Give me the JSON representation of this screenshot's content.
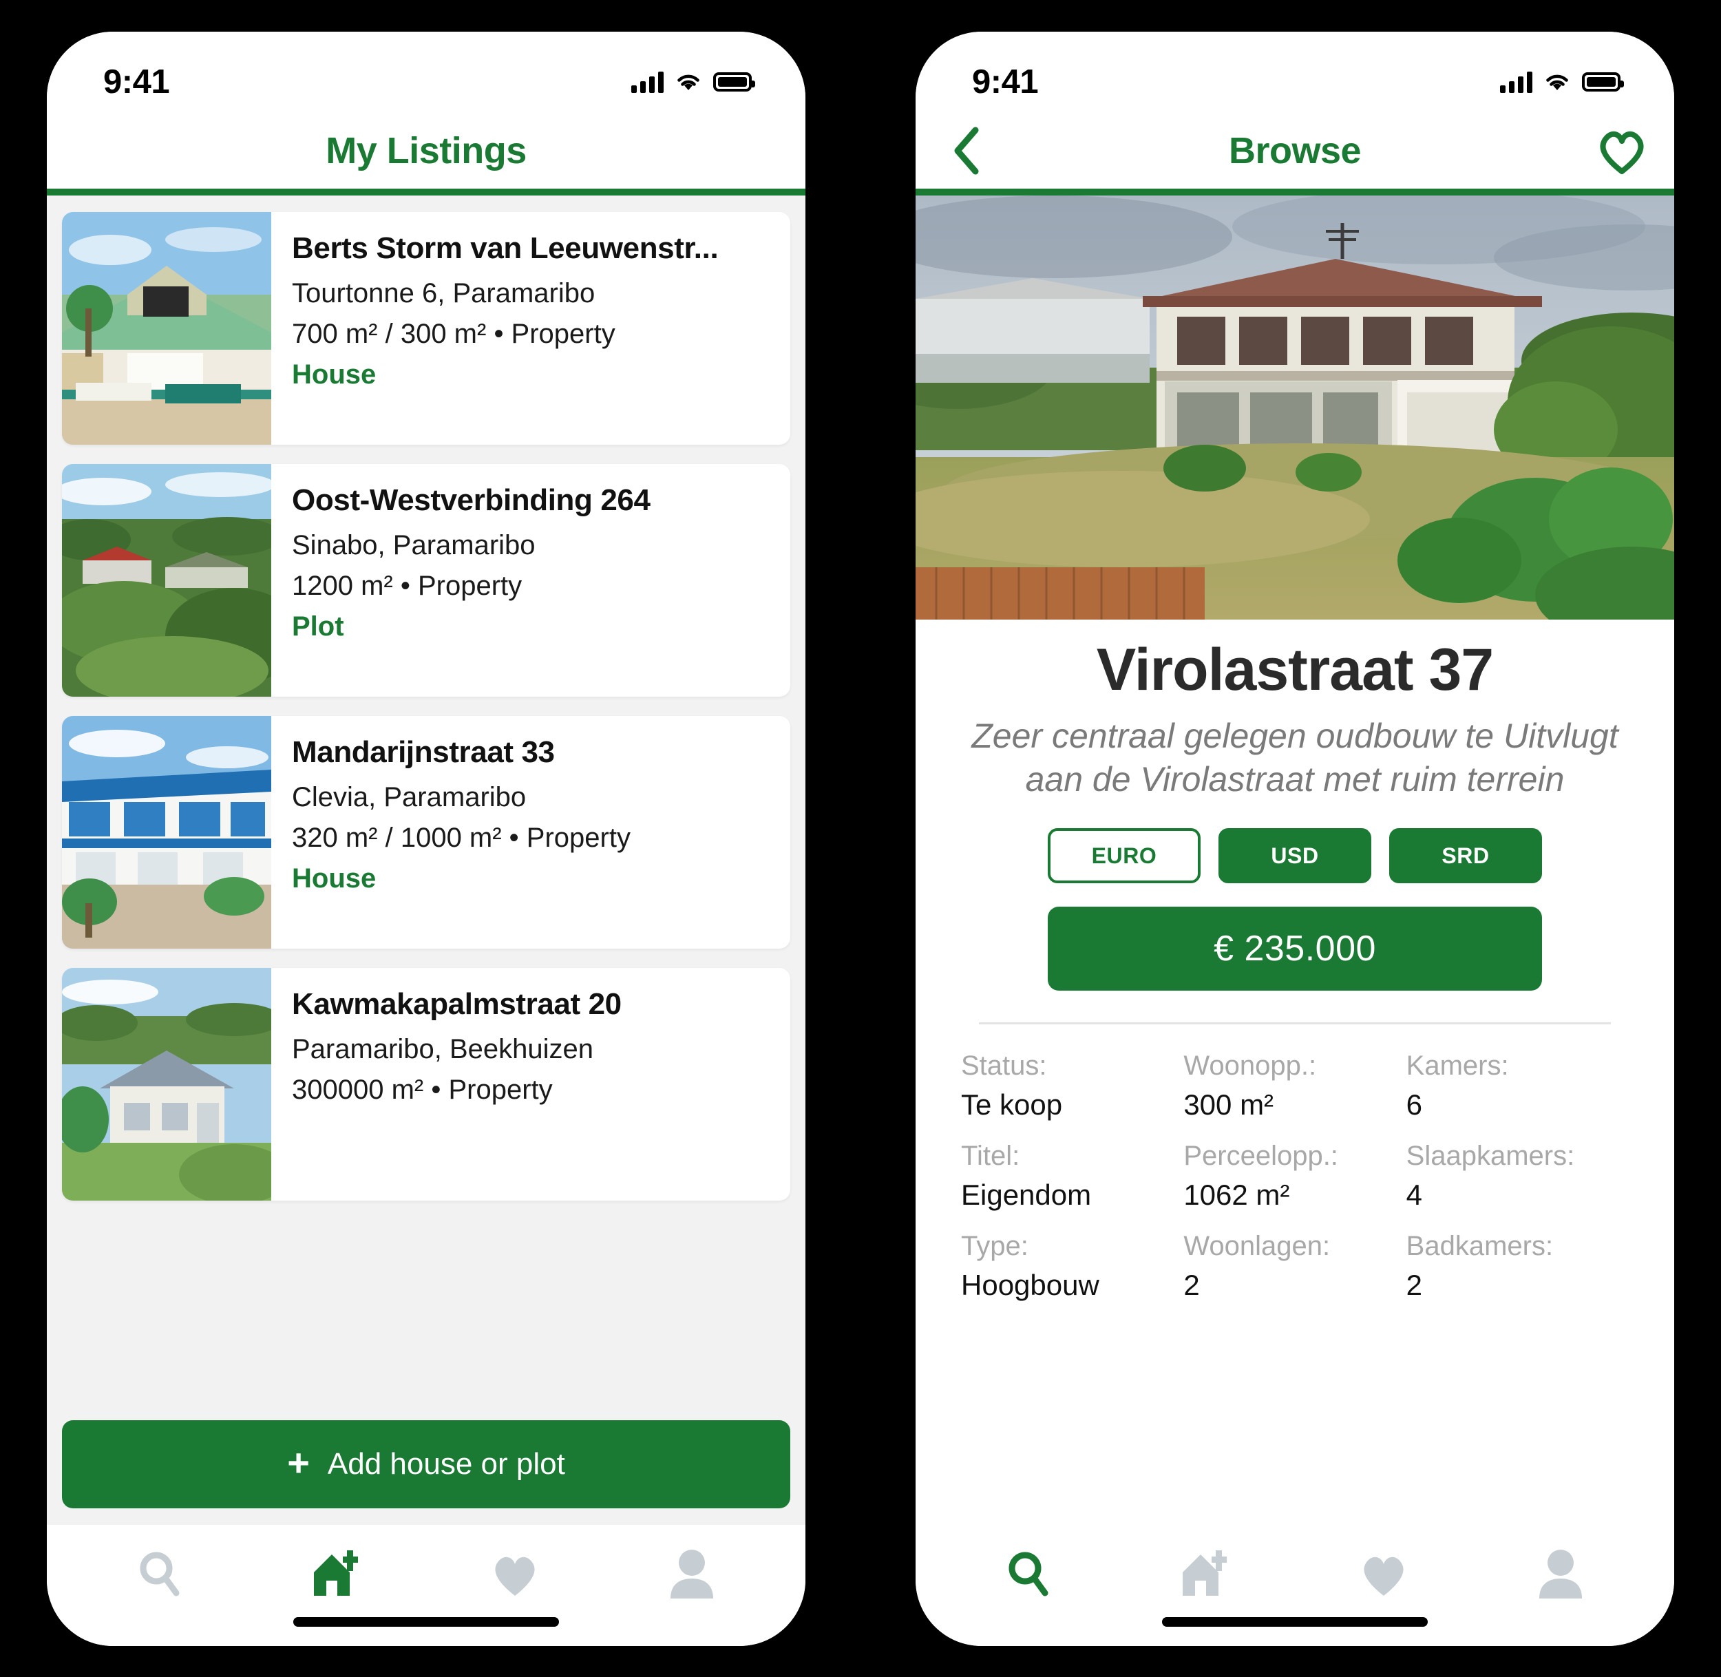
{
  "theme": {
    "brand_green": "#1a7a34",
    "page_bg": "#f2f2f2",
    "muted_gray": "#a8a8a8"
  },
  "left_phone": {
    "status": {
      "time": "9:41",
      "cellular_icon": "signal-bars-icon",
      "wifi_icon": "wifi-icon",
      "battery_icon": "battery-icon"
    },
    "header": {
      "title": "My Listings"
    },
    "listings": [
      {
        "title": "Berts Storm van Leeuwenstr...",
        "location": "Tourtonne 6, Paramaribo",
        "size": "700 m² / 300 m² • Property",
        "tag": "House",
        "thumb": "house-green-roof-photo"
      },
      {
        "title": "Oost-Westverbinding 264",
        "location": "Sinabo, Paramaribo",
        "size": "1200 m² • Property",
        "tag": "Plot",
        "thumb": "aerial-jungle-plot-photo"
      },
      {
        "title": "Mandarijnstraat 33",
        "location": "Clevia, Paramaribo",
        "size": "320 m² / 1000 m² • Property",
        "tag": "House",
        "thumb": "blue-white-building-photo"
      },
      {
        "title": "Kawmakapalmstraat 20",
        "location": "Paramaribo,  Beekhuizen",
        "size": "300000 m² • Property",
        "tag": "",
        "thumb": "grey-roof-house-photo"
      }
    ],
    "add_button": {
      "label": "Add house or plot",
      "icon": "plus-icon"
    },
    "tabs": [
      {
        "name": "search",
        "icon": "search-icon",
        "active": false
      },
      {
        "name": "add-listing",
        "icon": "house-plus-icon",
        "active": true
      },
      {
        "name": "favorites",
        "icon": "heart-icon",
        "active": false
      },
      {
        "name": "profile",
        "icon": "person-icon",
        "active": false
      }
    ]
  },
  "right_phone": {
    "status": {
      "time": "9:41",
      "cellular_icon": "signal-bars-icon",
      "wifi_icon": "wifi-icon",
      "battery_icon": "battery-icon"
    },
    "header": {
      "title": "Browse",
      "back_icon": "chevron-left-icon",
      "favorite_icon": "heart-outline-icon"
    },
    "hero": {
      "image": "two-story-white-house-photo"
    },
    "detail": {
      "title": "Virolastraat 37",
      "subtitle": "Zeer centraal gelegen oudbouw te Uitvlugt aan de Virolastraat met ruim terrein",
      "currencies": [
        {
          "label": "EURO",
          "selected": true
        },
        {
          "label": "USD",
          "selected": false
        },
        {
          "label": "SRD",
          "selected": false
        }
      ],
      "price": "€ 235.000",
      "specs": [
        {
          "label": "Status:",
          "value": "Te koop"
        },
        {
          "label": "Woonopp.:",
          "value": "300 m²"
        },
        {
          "label": "Kamers:",
          "value": "6"
        },
        {
          "label": "Titel:",
          "value": "Eigendom"
        },
        {
          "label": "Perceelopp.:",
          "value": "1062 m²"
        },
        {
          "label": "Slaapkamers:",
          "value": "4"
        },
        {
          "label": "Type:",
          "value": "Hoogbouw"
        },
        {
          "label": "Woonlagen:",
          "value": "2"
        },
        {
          "label": "Badkamers:",
          "value": "2"
        }
      ]
    },
    "tabs": [
      {
        "name": "search",
        "icon": "search-icon",
        "active": true
      },
      {
        "name": "add-listing",
        "icon": "house-plus-icon",
        "active": false
      },
      {
        "name": "favorites",
        "icon": "heart-icon",
        "active": false
      },
      {
        "name": "profile",
        "icon": "person-icon",
        "active": false
      }
    ]
  }
}
